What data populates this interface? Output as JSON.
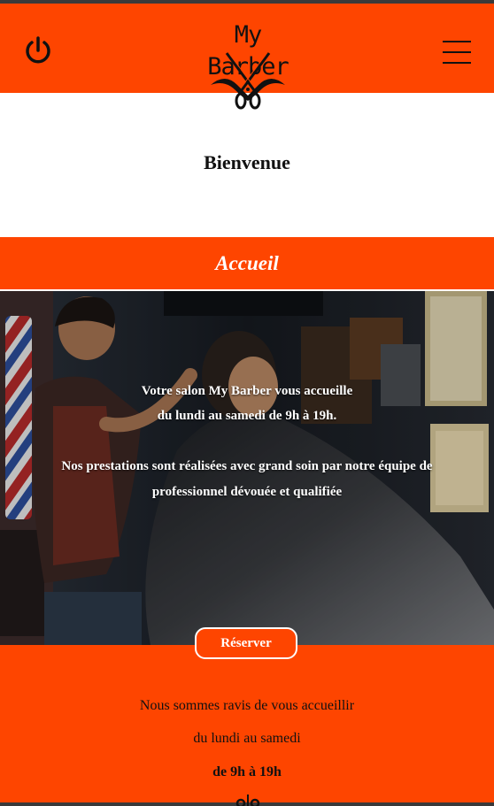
{
  "header": {
    "logo_text": "My Barber",
    "power_icon": "power-icon",
    "menu_icon": "hamburger-menu-icon"
  },
  "welcome": {
    "title": "Bienvenue"
  },
  "section": {
    "title": "Accueil"
  },
  "hero": {
    "line1": "Votre salon My Barber vous accueille",
    "line2": "du lundi au samedi de 9h à 19h.",
    "line3": "Nos prestations sont réalisées avec grand soin par notre équipe de",
    "line4": "professionnel dévouée et qualifiée"
  },
  "cta": {
    "reserve_label": "Réserver"
  },
  "info": {
    "line1": "Nous sommes ravis de vous accueillir",
    "line2": "du lundi au samedi",
    "line3": "de 9h à 19h"
  },
  "colors": {
    "brand": "#fe4500",
    "text_dark": "#111111",
    "white": "#ffffff"
  }
}
